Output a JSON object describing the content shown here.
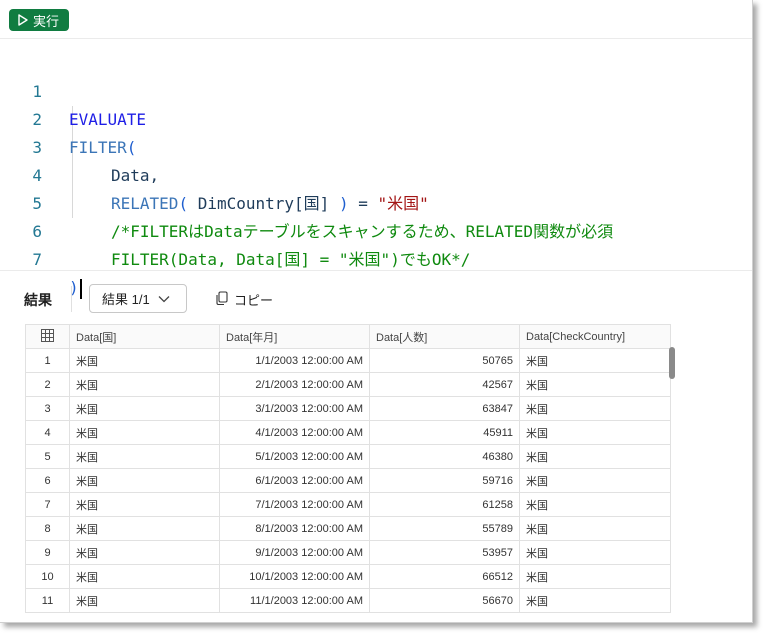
{
  "toolbar": {
    "run_label": "実行"
  },
  "editor": {
    "line_numbers": [
      "1",
      "2",
      "3",
      "4",
      "5",
      "6",
      "7"
    ],
    "lines": {
      "l1": "EVALUATE",
      "l2_fn": "FILTER",
      "l2_paren": "(",
      "l3": "Data,",
      "l4_fn": "RELATED",
      "l4_open": "(",
      "l4_arg": "DimCountry[国]",
      "l4_close": ")",
      "l4_eq": "=",
      "l4_str": "\"米国\"",
      "l5": "/*FILTERはDataテーブルをスキャンするため、RELATED関数が必須",
      "l6": "FILTER(Data, Data[国] = \"米国\")でもOK*/",
      "l7": ")"
    }
  },
  "results": {
    "title": "結果",
    "select_value": "結果 1/1",
    "copy_label": "コピー",
    "columns": [
      "Data[国]",
      "Data[年月]",
      "Data[人数]",
      "Data[CheckCountry]"
    ],
    "rows": [
      [
        "1",
        "米国",
        "1/1/2003 12:00:00 AM",
        "50765",
        "米国"
      ],
      [
        "2",
        "米国",
        "2/1/2003 12:00:00 AM",
        "42567",
        "米国"
      ],
      [
        "3",
        "米国",
        "3/1/2003 12:00:00 AM",
        "63847",
        "米国"
      ],
      [
        "4",
        "米国",
        "4/1/2003 12:00:00 AM",
        "45911",
        "米国"
      ],
      [
        "5",
        "米国",
        "5/1/2003 12:00:00 AM",
        "46380",
        "米国"
      ],
      [
        "6",
        "米国",
        "6/1/2003 12:00:00 AM",
        "59716",
        "米国"
      ],
      [
        "7",
        "米国",
        "7/1/2003 12:00:00 AM",
        "61258",
        "米国"
      ],
      [
        "8",
        "米国",
        "8/1/2003 12:00:00 AM",
        "55789",
        "米国"
      ],
      [
        "9",
        "米国",
        "9/1/2003 12:00:00 AM",
        "53957",
        "米国"
      ],
      [
        "10",
        "米国",
        "10/1/2003 12:00:00 AM",
        "66512",
        "米国"
      ],
      [
        "11",
        "米国",
        "11/1/2003 12:00:00 AM",
        "56670",
        "米国"
      ]
    ]
  },
  "colors": {
    "run_button": "#107c41",
    "keyword": "#1e1ee6",
    "comment": "#0f8a0f",
    "string": "#a31515"
  }
}
